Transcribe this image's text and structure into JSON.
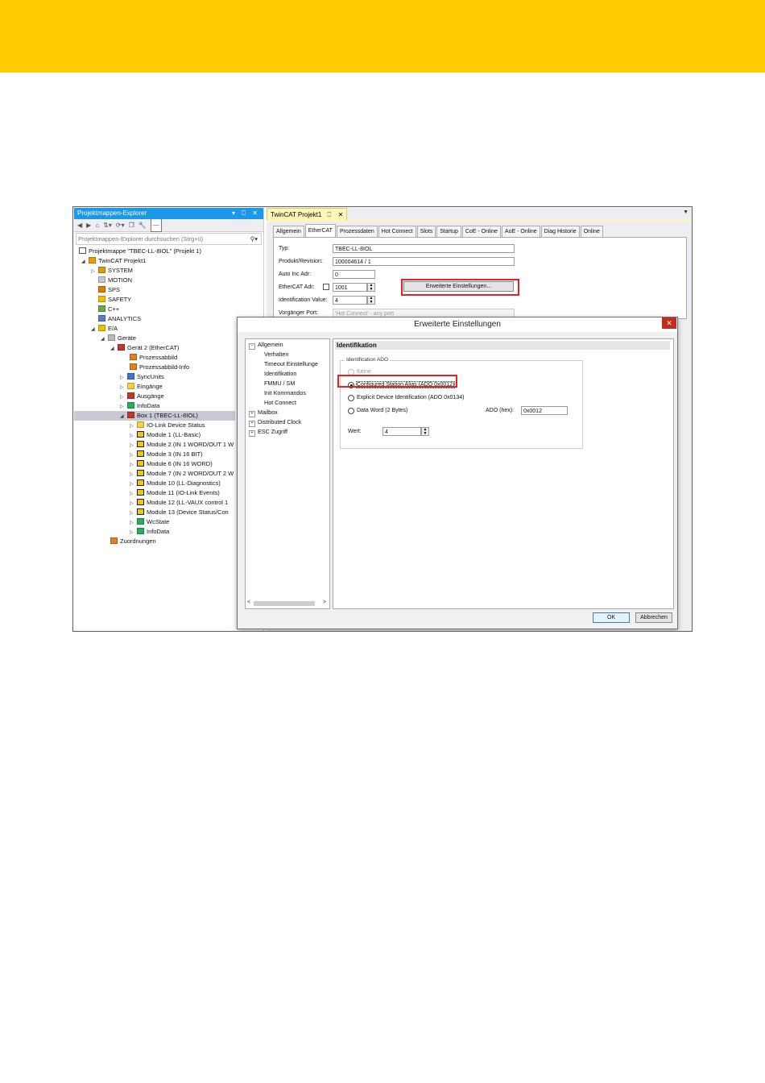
{
  "colors": {
    "topbar": "#ffcc00",
    "title_accent": "#1c97ea",
    "highlight": "#e02424"
  },
  "solution_explorer": {
    "title": "Projektmappen-Explorer",
    "title_controls": "▾ ⎕ ✕",
    "search_placeholder": "Projektmappen-Explorer durchsuchen (Strg+ü)",
    "tree": [
      {
        "label": "Projektmappe \"TBEC-LL-8IOL\" (Projekt 1)"
      },
      {
        "label": "TwinCAT Projekt1"
      },
      {
        "label": "SYSTEM"
      },
      {
        "label": "MOTION"
      },
      {
        "label": "SPS"
      },
      {
        "label": "SAFETY"
      },
      {
        "label": "C++"
      },
      {
        "label": "ANALYTICS"
      },
      {
        "label": "E/A"
      },
      {
        "label": "Geräte"
      },
      {
        "label": "Gerät 2 (EtherCAT)"
      },
      {
        "label": "Prozessabbild"
      },
      {
        "label": "Prozessabbild-Info"
      },
      {
        "label": "SyncUnits"
      },
      {
        "label": "Eingänge"
      },
      {
        "label": "Ausgänge"
      },
      {
        "label": "InfoData"
      },
      {
        "label": "Box 1 (TBEC-LL-8IOL)"
      },
      {
        "label": "IO-Link Device Status"
      },
      {
        "label": "Module 1 (LL-Basic)"
      },
      {
        "label": "Module 2 (IN 1 WORD/OUT 1 W"
      },
      {
        "label": "Module 3 (IN 16 BIT)"
      },
      {
        "label": "Module 6 (IN 16 WORD)"
      },
      {
        "label": "Module 7 (IN 2 WORD/OUT 2 W"
      },
      {
        "label": "Module 10 (LL-Diagnostics)"
      },
      {
        "label": "Module 11 (IO-Link Events)"
      },
      {
        "label": "Module 12 (LL-VAUX control 1"
      },
      {
        "label": "Module 13 (Device Status/Con"
      },
      {
        "label": "WcState"
      },
      {
        "label": "InfoData"
      },
      {
        "label": "Zuordnungen"
      }
    ]
  },
  "document": {
    "tab_label": "TwinCAT Projekt1",
    "tab_pin": "⎕",
    "tab_close": "✕",
    "tabs": [
      "Allgemein",
      "EtherCAT",
      "Prozessdaten",
      "Hot Connect",
      "Slots",
      "Startup",
      "CoE - Online",
      "AoE - Online",
      "Diag Historie",
      "Online"
    ],
    "fields": {
      "typ_label": "Typ:",
      "typ_value": "TBEC-LL-8IOL",
      "rev_label": "Produkt/Revision:",
      "rev_value": "100004614 / 1",
      "autoinc_label": "Auto Inc Adr:",
      "autoinc_value": "0",
      "ecadr_label": "EtherCAT Adr:",
      "ecadr_value": "1001",
      "ident_label": "Identification Value:",
      "ident_value": "4",
      "port_label": "Vorgänger Port:",
      "port_value": "'Hot Connect' - any port"
    },
    "advanced_button": "Erweiterte Einstellungen..."
  },
  "dialog": {
    "title": "Erweiterte Einstellungen",
    "close": "✕",
    "tree": [
      {
        "label": "Allgemein"
      },
      {
        "label": "Verhalten"
      },
      {
        "label": "Timeout Einstellunge"
      },
      {
        "label": "Identifikation"
      },
      {
        "label": "FMMU / SM"
      },
      {
        "label": "Init Kommandos"
      },
      {
        "label": "Hot Connect"
      },
      {
        "label": "Mailbox"
      },
      {
        "label": "Distributed Clock"
      },
      {
        "label": "ESC Zugriff"
      }
    ],
    "section_title": "Identifikation",
    "group_caption": "Identification ADO",
    "options": {
      "none": "Keine",
      "configured_alias": "Configured Station Alias (ADO 0x0012)",
      "explicit": "Explicit Device Identification (ADO 0x0134)",
      "data_word": "Data Word (2 Bytes)"
    },
    "ado_label": "ADO (hex):",
    "ado_value": "0x0012",
    "wert_label": "Wert:",
    "wert_value": "4",
    "ok": "OK",
    "cancel": "Abbrechen"
  }
}
